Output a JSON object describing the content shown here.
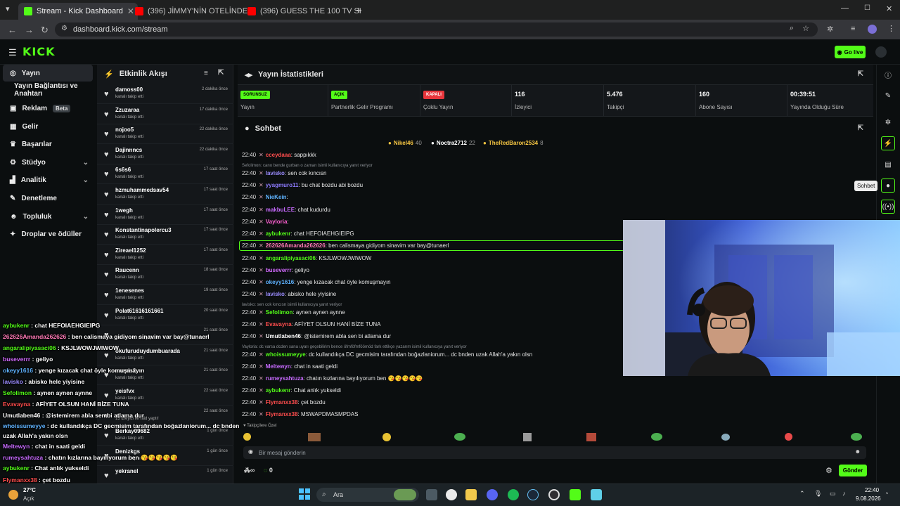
{
  "browser": {
    "tabs": [
      {
        "label": "Stream - Kick Dashboard",
        "active": true
      },
      {
        "label": "(396) JİMMY'NİN OTELİNDE NE",
        "active": false
      },
      {
        "label": "(396) GUESS THE 100 TV SHOW",
        "active": false
      }
    ],
    "url": "dashboard.kick.com/stream"
  },
  "header": {
    "logo": "KICK",
    "go_live": "Go live"
  },
  "sidebar": {
    "items": [
      {
        "label": "Yayın",
        "icon": "broadcast-icon"
      },
      {
        "label": "Yayın Bağlantısı ve Anahtarı",
        "icon": ""
      },
      {
        "label": "Reklam",
        "icon": "ad-icon",
        "badge": "Beta"
      },
      {
        "label": "Gelir",
        "icon": "revenue-icon"
      },
      {
        "label": "Başarılar",
        "icon": "trophy-icon"
      },
      {
        "label": "Stüdyo",
        "icon": "studio-icon"
      },
      {
        "label": "Analitik",
        "icon": "chart-icon"
      },
      {
        "label": "Denetleme",
        "icon": "hammer-icon"
      },
      {
        "label": "Topluluk",
        "icon": "community-icon"
      },
      {
        "label": "Droplar ve ödüller",
        "icon": "gift-icon"
      }
    ]
  },
  "activity": {
    "title": "Etkinlik Akışı",
    "items": [
      {
        "name": "damoss00",
        "sub": "kanalı takip etti",
        "time": "2 dakika önce"
      },
      {
        "name": "Zzuzaraa",
        "sub": "kanalı takip etti",
        "time": "17 dakika önce"
      },
      {
        "name": "nojoo5",
        "sub": "kanalı takip etti",
        "time": "22 dakika önce"
      },
      {
        "name": "Dajinnncs",
        "sub": "kanalı takip etti",
        "time": "22 dakika önce"
      },
      {
        "name": "6s6s6",
        "sub": "kanalı takip etti",
        "time": "17 saat önce"
      },
      {
        "name": "hzmuhammedsav54",
        "sub": "kanalı takip etti",
        "time": "17 saat önce"
      },
      {
        "name": "1wegh",
        "sub": "kanalı takip etti",
        "time": "17 saat önce"
      },
      {
        "name": "Konstantinapolercu3",
        "sub": "kanalı takip etti",
        "time": "17 saat önce"
      },
      {
        "name": "Zireael1252",
        "sub": "kanalı takip etti",
        "time": "17 saat önce"
      },
      {
        "name": "Raucenn",
        "sub": "kanalı takip etti",
        "time": "18 saat önce"
      },
      {
        "name": "1enesenes",
        "sub": "kanalı takip etti",
        "time": "19 saat önce"
      },
      {
        "name": "Polat61616161661",
        "sub": "kanalı takip etti",
        "time": "20 saat önce"
      },
      {
        "name": "",
        "sub": "5 izleyici ile raid yaptı!",
        "time": "21 saat önce"
      },
      {
        "name": "okufuruduydumbuarada",
        "sub": "kanalı takip etti",
        "time": "21 saat önce"
      },
      {
        "name": "nwmis2",
        "sub": "kanalı takip etti",
        "time": "21 saat önce"
      },
      {
        "name": "yeisfvx",
        "sub": "kanalı takip etti",
        "time": "22 saat önce"
      },
      {
        "name": "",
        "sub": "15 izleyici ile raid yaptı!",
        "time": "22 saat önce"
      },
      {
        "name": "Berkay09682",
        "sub": "kanalı takip etti",
        "time": "1 gün önce"
      },
      {
        "name": "Denizkgs",
        "sub": "kanalı takip etti",
        "time": "1 gün önce"
      },
      {
        "name": "yekranel",
        "sub": "",
        "time": "1 gün önce"
      }
    ]
  },
  "stats": {
    "title": "Yayın İstatistikleri",
    "cells": [
      {
        "badge": "SORUNSUZ",
        "badge_color": "#53fc18",
        "label": "Yayın"
      },
      {
        "badge": "AÇIK",
        "badge_color": "#53fc18",
        "label": "Partnerlik Gelir Programı"
      },
      {
        "badge": "KAPALI",
        "badge_color": "#e8363c",
        "label": "Çoklu Yayın"
      },
      {
        "value": "116",
        "label": "İzleyici"
      },
      {
        "value": "5.476",
        "label": "Takipçi"
      },
      {
        "value": "160",
        "label": "Abone Sayısı"
      },
      {
        "value": "00:39:51",
        "label": "Yayında Olduğu Süre"
      }
    ]
  },
  "chat": {
    "title": "Sohbet",
    "pinned": [
      {
        "name": "Nikel46",
        "count": "40",
        "color": "#f5c542"
      },
      {
        "name": "Noctra2712",
        "count": "22",
        "color": "#ffffff"
      },
      {
        "name": "TheRedBaron2534",
        "count": "8",
        "color": "#f5c542"
      }
    ],
    "messages": [
      {
        "kind": "msg",
        "time": "22:40",
        "user": "cceydaaa",
        "color": "#ff4d4d",
        "text": ": sappıkkk"
      },
      {
        "kind": "reply",
        "text": "Sefolimon: cano bende gurban o zaman isimli kullanıcıya yanıt veriyor"
      },
      {
        "kind": "msg",
        "time": "22:40",
        "user": "lavisko",
        "color": "#9b8cff",
        "text": ": sen cok kıncısn"
      },
      {
        "kind": "msg",
        "time": "22:40",
        "user": "yyagmuro11",
        "color": "#8e7bff",
        "text": ": bu chat bozdu abi bozdu"
      },
      {
        "kind": "msg",
        "time": "22:40",
        "user": "NieKein",
        "color": "#5fb3ff",
        "text": ":"
      },
      {
        "kind": "msg",
        "time": "22:40",
        "user": "makbuLEE",
        "color": "#c86bff",
        "text": ": chat kudurdu"
      },
      {
        "kind": "msg",
        "time": "22:40",
        "user": "Vayloria",
        "color": "#ff5fd2",
        "text": ":"
      },
      {
        "kind": "msg",
        "time": "22:40",
        "user": "aybukenr",
        "color": "#53fc18",
        "text": ": chat HEFOIAEHGIEIPG"
      },
      {
        "kind": "msg",
        "time": "22:40",
        "user": "262626Amanda262626",
        "color": "#ff7ab6",
        "text": ": ben calismaya gidiyom sinavim var bay@tunaerl"
      },
      {
        "kind": "msg",
        "time": "22:40",
        "user": "angaralipiyasaci06",
        "color": "#53fc18",
        "text": ": KSJLWOWJWIWOW"
      },
      {
        "kind": "msg",
        "time": "22:40",
        "user": "buseverrr",
        "color": "#d36bff",
        "text": ": geliyo"
      },
      {
        "kind": "msg",
        "time": "22:40",
        "user": "okeyy1616",
        "color": "#5fb3ff",
        "text": ": yenge kızacak chat öyle komuşmayın"
      },
      {
        "kind": "msg",
        "time": "22:40",
        "user": "lavisko",
        "color": "#9b8cff",
        "text": ": abisko hele yiyisine"
      },
      {
        "kind": "reply",
        "text": "lavisko: sen cok kıncısn isimli kullanıcıya yanıt veriyor"
      },
      {
        "kind": "msg",
        "time": "22:40",
        "user": "Sefolimon",
        "color": "#53fc18",
        "text": ": aynen aynen aynne"
      },
      {
        "kind": "msg",
        "time": "22:40",
        "user": "Evavayna",
        "color": "#ff4d4d",
        "text": ": AFİYET OLSUN HANİ BİZE TUNA"
      },
      {
        "kind": "msg",
        "time": "22:40",
        "user": "Umutlaben46",
        "color": "#ffffff",
        "text": ": @istemirem abla sen bi atlama dur"
      },
      {
        "kind": "reply",
        "text": "Vayloria: dc varsa dcden sana uyarı geçebilirim bence öfmföfmföömöd fark ettikçe yazarım isimli kullanıcıya yanıt veriyor"
      },
      {
        "kind": "msg",
        "time": "22:40",
        "user": "whoissumeyye",
        "color": "#53fc18",
        "text": ": dc kullandıkça DC gecmisim tarafından boğazlaniorum... dc bnden uzak Allah'a yakın olsn"
      },
      {
        "kind": "msg",
        "time": "22:40",
        "user": "Meltewyn",
        "color": "#c86bff",
        "text": ": chat in saati geldi"
      },
      {
        "kind": "msg",
        "time": "22:40",
        "user": "rumeysahtuza",
        "color": "#c86bff",
        "text": ": chatın kızlarına bayılıyorum ben 😘😘😘😘😘"
      },
      {
        "kind": "msg",
        "time": "22:40",
        "user": "aybukenr",
        "color": "#53fc18",
        "text": ": Chat anlık yukseldi"
      },
      {
        "kind": "msg",
        "time": "22:40",
        "user": "Flymanxx38",
        "color": "#ff4d4d",
        "text": ": çet bozdu"
      },
      {
        "kind": "msg",
        "time": "22:40",
        "user": "Flymanxx38",
        "color": "#ff4d4d",
        "text": ": MSWAPDMASMPDAS"
      }
    ],
    "followers_only": "Takipçilere Özel",
    "input_placeholder": "Bir mesaj gönderin",
    "send": "Gönder",
    "points": "0",
    "tooltip": "Sohbet"
  },
  "overlay": {
    "lines": [
      {
        "user": "aybukenr",
        "color": "#53fc18",
        "text": " : chat HEFOIAEHGIEIPG"
      },
      {
        "user": "262626Amanda262626",
        "color": "#ff7ab6",
        "text": " : ben calismaya gidiyom sinavim var bay@tunaerl"
      },
      {
        "user": "angaralipiyasaci06",
        "color": "#53fc18",
        "text": " : KSJLWOWJWIWOW"
      },
      {
        "user": "buseverrr",
        "color": "#d36bff",
        "text": " : geliyo"
      },
      {
        "user": "okeyy1616",
        "color": "#5fb3ff",
        "text": " : yenge kızacak chat öyle komuşmayın"
      },
      {
        "user": "lavisko",
        "color": "#9b8cff",
        "text": " : abisko hele yiyisine"
      },
      {
        "user": "Sefolimon",
        "color": "#53fc18",
        "text": " : aynen aynen aynne"
      },
      {
        "user": "Evavayna",
        "color": "#ff4d4d",
        "text": " : AFİYET OLSUN HANİ BİZE TUNA"
      },
      {
        "user": "Umutlaben46",
        "color": "#ffffff",
        "text": " : @istemirem abla sen bi atlama dur"
      },
      {
        "user": "whoissumeyye",
        "color": "#5fb3ff",
        "text": " : dc kullandıkça DC gecmisim tarafından boğazlaniorum... dc bnden"
      },
      {
        "user": "",
        "color": "#ffffff",
        "text": "uzak Allah'a yakın olsn"
      },
      {
        "user": "Meltewyn",
        "color": "#c86bff",
        "text": " : chat in saati geldi"
      },
      {
        "user": "rumeysahtuza",
        "color": "#c86bff",
        "text": " : chatın kızlarına bayılıyorum ben 😘😘😘😘😘"
      },
      {
        "user": "aybukenr",
        "color": "#53fc18",
        "text": " : Chat anlık yukseldi"
      },
      {
        "user": "Flymanxx38",
        "color": "#ff4d4d",
        "text": " : çet bozdu"
      },
      {
        "user": "Flymanxx38",
        "color": "#ff4d4d",
        "text": " : MSWAPDMASMPDAS"
      }
    ]
  },
  "taskbar": {
    "weather_temp": "27°C",
    "weather_label": "Açık",
    "search": "Ara",
    "time": "22:40",
    "date": "9.08.2026"
  }
}
